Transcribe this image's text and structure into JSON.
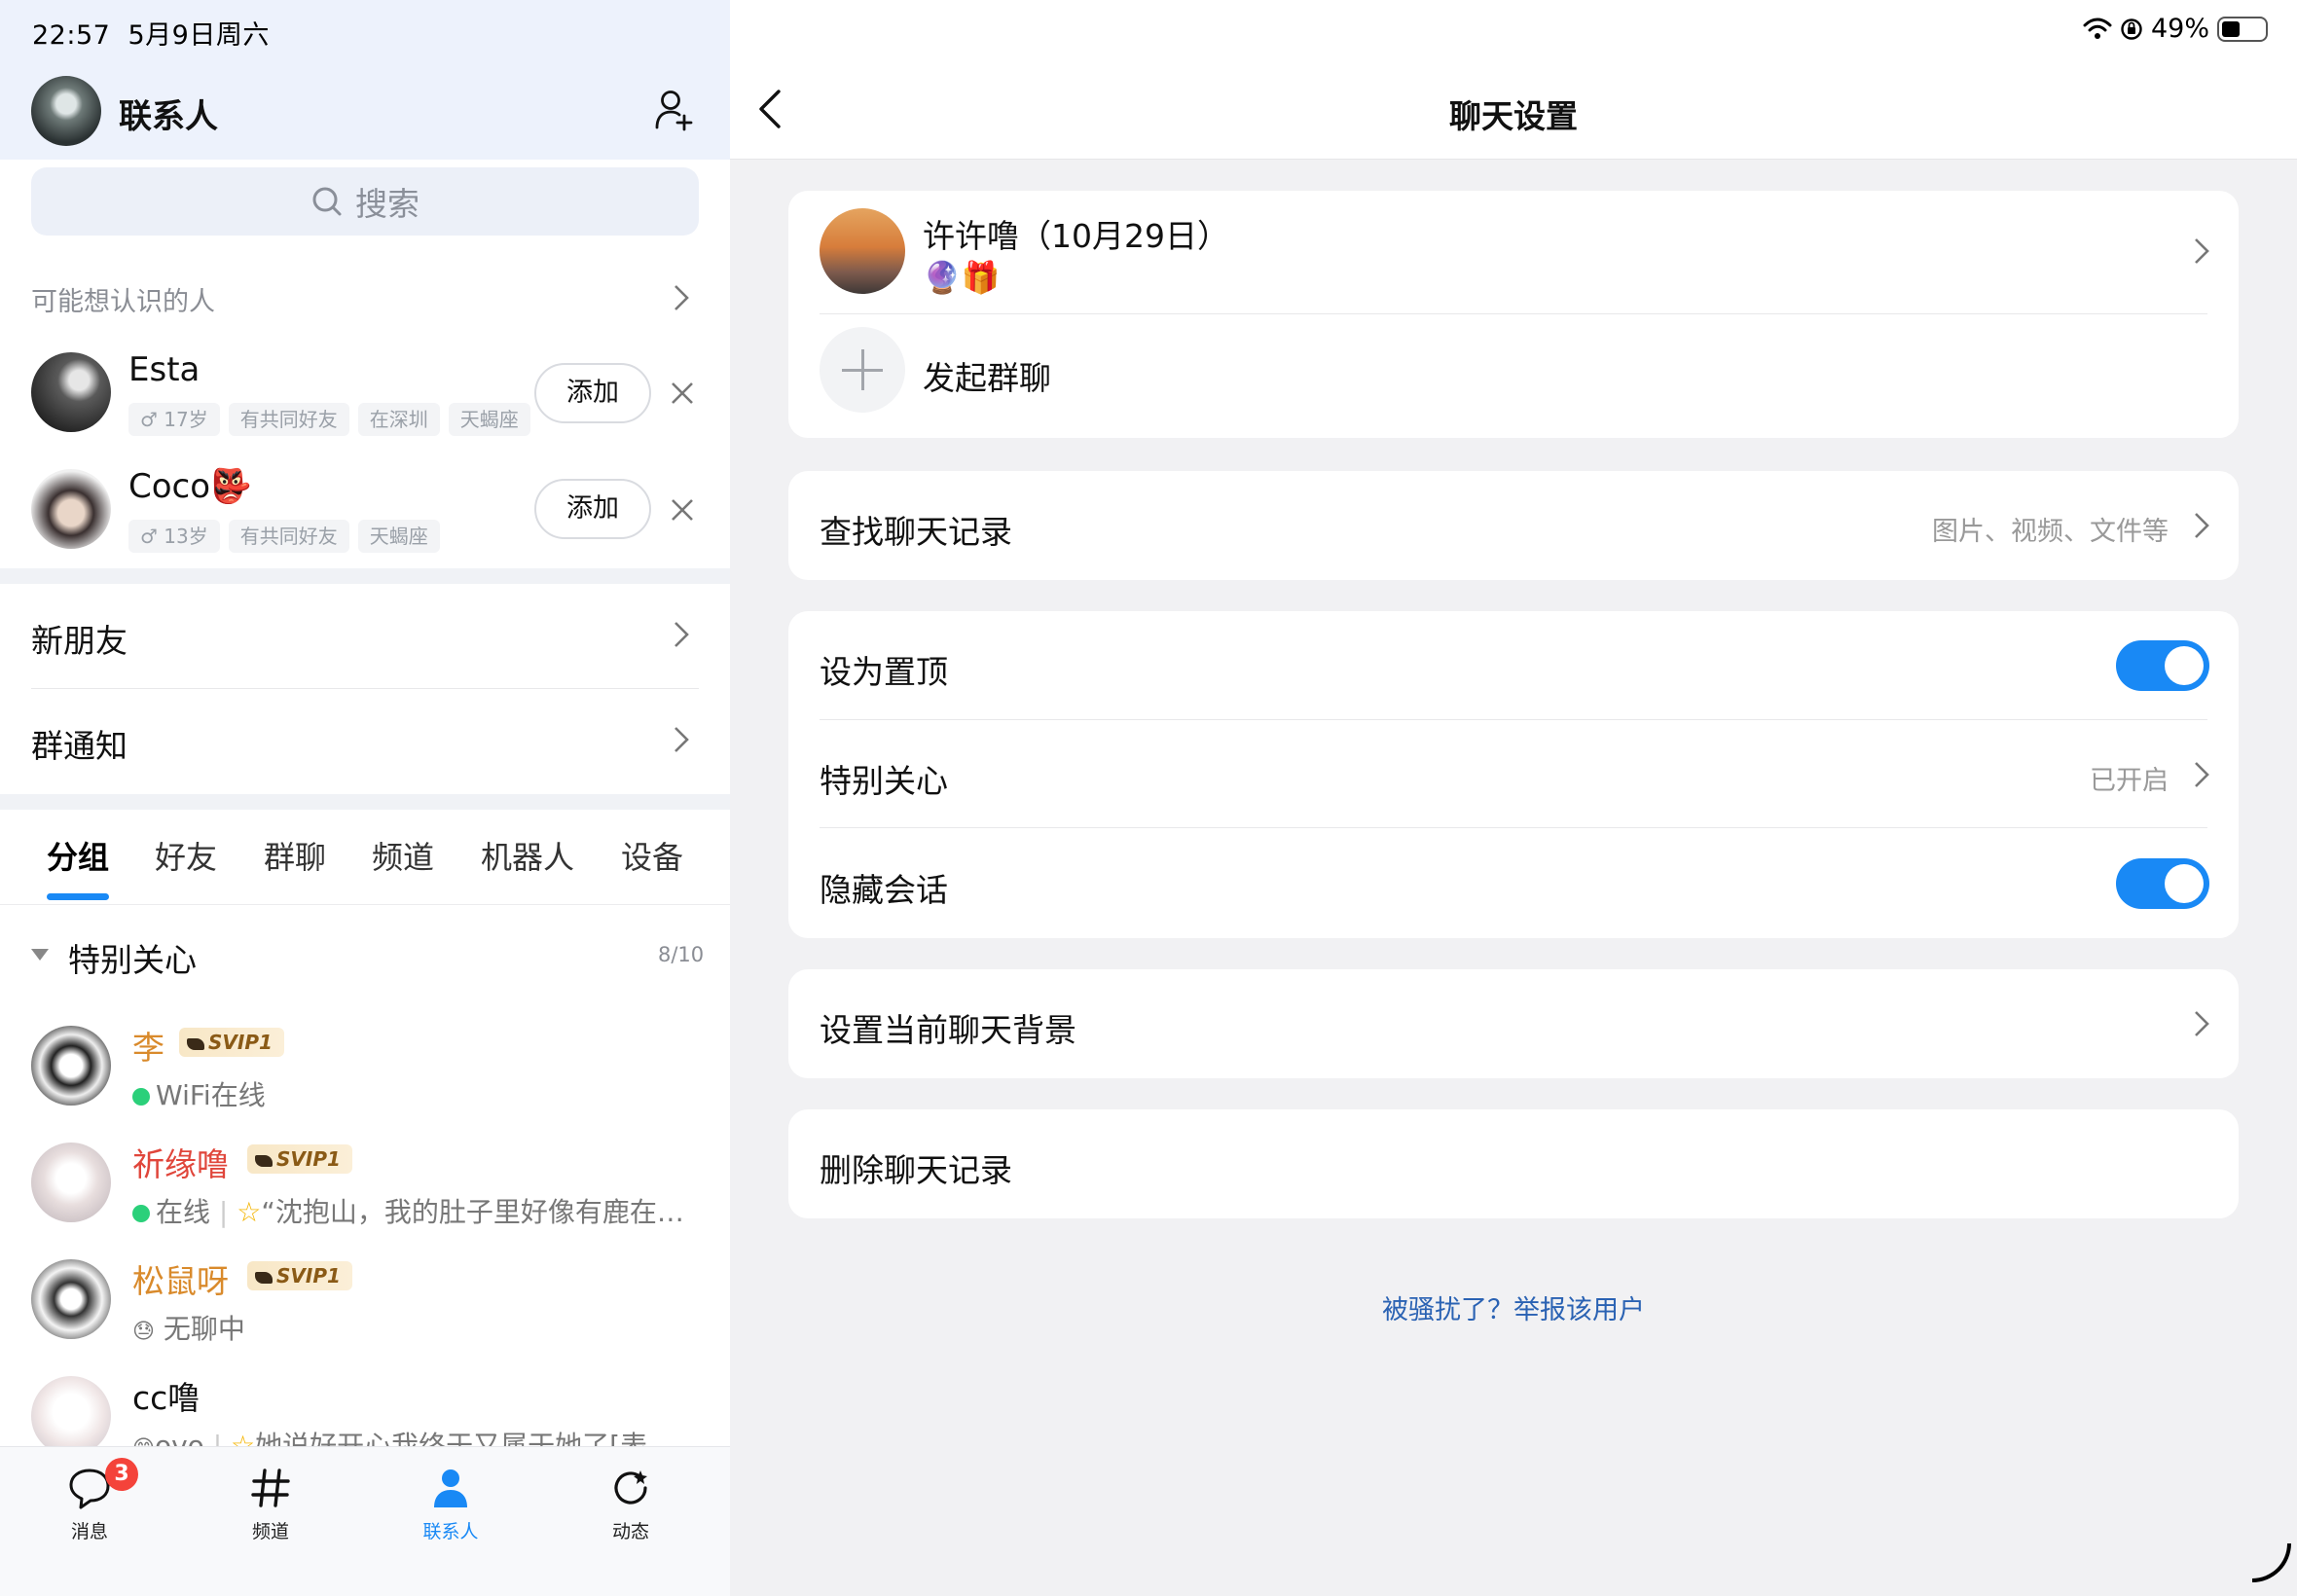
{
  "status_bar": {
    "time": "22:57",
    "date": "5月9日周六",
    "battery": "49%"
  },
  "left": {
    "title": "联系人",
    "search_placeholder": "搜索",
    "may_know": {
      "heading": "可能想认识的人",
      "people": [
        {
          "name": "Esta",
          "tags": [
            "♂ 17岁",
            "有共同好友",
            "在深圳",
            "天蝎座"
          ],
          "add_label": "添加"
        },
        {
          "name": "Coco👺",
          "tags": [
            "♂ 13岁",
            "有共同好友",
            "天蝎座"
          ],
          "add_label": "添加"
        }
      ]
    },
    "rows": {
      "new_friends": "新朋友",
      "group_notice": "群通知"
    },
    "tabs": [
      "分组",
      "好友",
      "群聊",
      "频道",
      "机器人",
      "设备"
    ],
    "group": {
      "title": "特别关心",
      "count": "8/10"
    },
    "contacts": [
      {
        "name": "李",
        "name_color": "#d98a2b",
        "badge": "SVIP1",
        "status": "WiFi在线"
      },
      {
        "name": "祈缘噜",
        "name_color": "#e0463b",
        "badge": "SVIP1",
        "status": "在线",
        "signature": "“沈抱山，我的肚子里好像有鹿在…"
      },
      {
        "name": "松鼠呀",
        "name_color": "#d98a2b",
        "badge": "SVIP1",
        "status": "无聊中"
      },
      {
        "name": "cc噜",
        "name_color": "#111111",
        "badge": "",
        "status": "ovo",
        "signature": "她说好开心我终于又属于她了[表"
      }
    ],
    "nav": [
      {
        "label": "消息",
        "icon": "chat-bubble-icon",
        "badge": "3"
      },
      {
        "label": "频道",
        "icon": "hash-icon"
      },
      {
        "label": "联系人",
        "icon": "person-icon",
        "active": true
      },
      {
        "label": "动态",
        "icon": "refresh-star-icon"
      }
    ]
  },
  "right": {
    "title": "聊天设置",
    "friend": {
      "name": "许许噜（10月29日）",
      "emojis": "🔮🎁"
    },
    "start_group": "发起群聊",
    "search_history": {
      "label": "查找聊天记录",
      "hint": "图片、视频、文件等"
    },
    "pin": {
      "label": "设为置顶",
      "on": true
    },
    "special_care": {
      "label": "特别关心",
      "hint": "已开启"
    },
    "hide_chat": {
      "label": "隐藏会话",
      "on": true
    },
    "background": {
      "label": "设置当前聊天背景"
    },
    "delete_history": {
      "label": "删除聊天记录"
    },
    "report": "被骚扰了？举报该用户"
  },
  "colors": {
    "accent": "#1989f5",
    "link": "#2a62b3",
    "badge_red": "#f4433a"
  }
}
